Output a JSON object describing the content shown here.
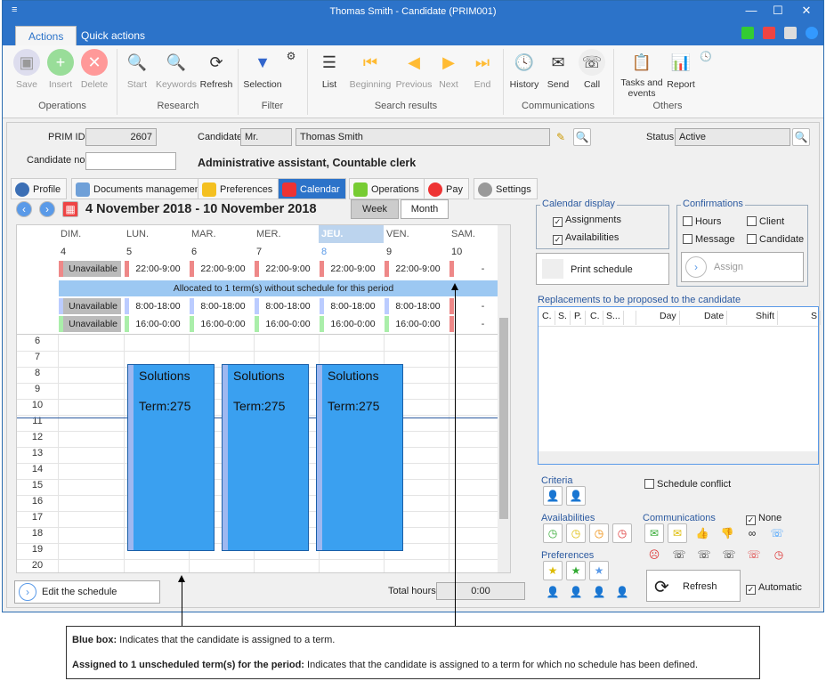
{
  "window": {
    "title": "Thomas Smith - Candidate (PRIM001)",
    "menu_glyph": "≡",
    "minimize": "—",
    "maximize": "☐",
    "close": "✕"
  },
  "ribbon_tabs": [
    "Actions",
    "Quick actions"
  ],
  "ribbon": {
    "operations": {
      "label": "Operations",
      "save": "Save",
      "insert": "Insert",
      "delete": "Delete"
    },
    "research": {
      "label": "Research",
      "start": "Start",
      "keywords": "Keywords",
      "refresh": "Refresh"
    },
    "filter": {
      "label": "Filter",
      "selection": "Selection"
    },
    "search_results": {
      "label": "Search results",
      "list": "List",
      "beginning": "Beginning",
      "previous": "Previous",
      "next": "Next",
      "end": "End"
    },
    "communications": {
      "label": "Communications",
      "history": "History",
      "send": "Send",
      "call": "Call"
    },
    "others": {
      "label": "Others",
      "tasks": "Tasks and events",
      "report": "Report"
    }
  },
  "form": {
    "prim_id_label": "PRIM ID",
    "prim_id": "2607",
    "candidate_label": "Candidate",
    "title": "Mr.",
    "name": "Thomas Smith",
    "status_label": "Status",
    "status": "Active",
    "candidate_no_label": "Candidate no.",
    "candidate_no": "",
    "position": "Administrative assistant, Countable clerk"
  },
  "tabs": [
    "Profile",
    "Documents management",
    "Preferences",
    "Calendar",
    "Operations",
    "Pay",
    "Settings"
  ],
  "calendar": {
    "range": "4 November 2018 - 10 November 2018",
    "week": "Week",
    "month": "Month",
    "days": [
      {
        "name": "DIM.",
        "num": "4"
      },
      {
        "name": "LUN.",
        "num": "5"
      },
      {
        "name": "MAR.",
        "num": "6"
      },
      {
        "name": "MER.",
        "num": "7"
      },
      {
        "name": "JEU.",
        "num": "8"
      },
      {
        "name": "VEN.",
        "num": "9"
      },
      {
        "name": "SAM.",
        "num": "10"
      }
    ],
    "row1": [
      "Unavailable",
      "22:00-9:00",
      "22:00-9:00",
      "22:00-9:00",
      "22:00-9:00",
      "22:00-9:00",
      "-"
    ],
    "banner": "Allocated to 1 term(s) without schedule for this period",
    "row2": [
      "Unavailable",
      "8:00-18:00",
      "8:00-18:00",
      "8:00-18:00",
      "8:00-18:00",
      "8:00-18:00",
      "-"
    ],
    "row3": [
      "Unavailable",
      "16:00-0:00",
      "16:00-0:00",
      "16:00-0:00",
      "16:00-0:00",
      "16:00-0:00",
      "-"
    ],
    "hours": [
      "6",
      "7",
      "8",
      "9",
      "10",
      "11",
      "12",
      "13",
      "14",
      "15",
      "16",
      "17",
      "18",
      "19",
      "20"
    ],
    "blocks": [
      {
        "title": "Solutions",
        "term": "Term:275"
      },
      {
        "title": "Solutions",
        "term": "Term:275"
      },
      {
        "title": "Solutions",
        "term": "Term:275"
      }
    ],
    "edit_schedule": "Edit the schedule",
    "total_hours_label": "Total hours",
    "total_hours": "0:00"
  },
  "right": {
    "calendar_display": "Calendar display",
    "assignments": "Assignments",
    "availabilities": "Availabilities",
    "print_schedule": "Print schedule",
    "confirmations": "Confirmations",
    "hours": "Hours",
    "client": "Client",
    "message": "Message",
    "candidate": "Candidate",
    "assign": "Assign",
    "replacements": "Replacements to be proposed to the candidate",
    "columns": [
      "C.",
      "S.",
      "P.",
      "C.",
      "S...",
      "",
      "Day",
      "Date",
      "Shift",
      "S"
    ],
    "criteria": "Criteria",
    "schedule_conflict": "Schedule conflict",
    "availabilities2": "Availabilities",
    "communications": "Communications",
    "none": "None",
    "preferences": "Preferences",
    "refresh": "Refresh",
    "automatic": "Automatic"
  },
  "callout": {
    "b1": "Blue box:",
    "t1": " Indicates that the candidate is assigned to a term.",
    "b2": "Assigned to 1 unscheduled term(s) for the period:",
    "t2": " Indicates that the candidate is assigned to a term for which no schedule has been defined."
  }
}
